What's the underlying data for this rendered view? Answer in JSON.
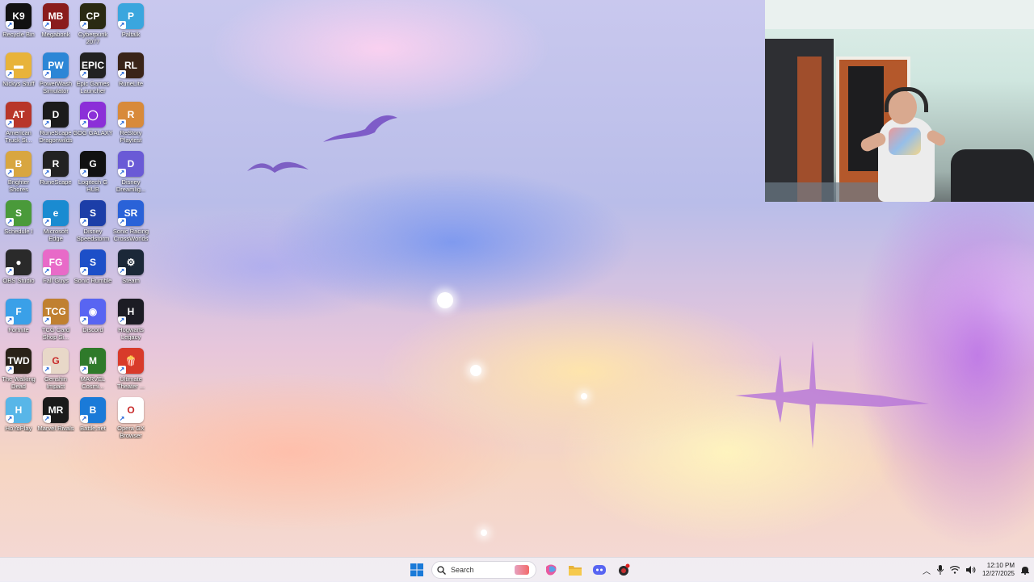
{
  "desktop_icons": [
    {
      "label": "Recycle Bin",
      "icon": "k9-icon",
      "color": "#111111",
      "glyph": "K9"
    },
    {
      "label": "Megabonk",
      "icon": "megabonk-icon",
      "color": "#8a1c1c",
      "glyph": "MB"
    },
    {
      "label": "Cyberpunk 2077",
      "icon": "cyberpunk-icon",
      "color": "#2a2a12",
      "glyph": "CP"
    },
    {
      "label": "Paltalk",
      "icon": "paltalk-icon",
      "color": "#3aa6de",
      "glyph": "P"
    },
    {
      "label": "Nickys Stuff",
      "icon": "folder-icon",
      "color": "#e8b33a",
      "glyph": "▬"
    },
    {
      "label": "PowerWash Simulator",
      "icon": "powerwash-icon",
      "color": "#2c86d6",
      "glyph": "PW"
    },
    {
      "label": "Epic Games Launcher",
      "icon": "epic-games-icon",
      "color": "#222222",
      "glyph": "EPIC"
    },
    {
      "label": "RuneLite",
      "icon": "runelite-icon",
      "color": "#3a2418",
      "glyph": "RL"
    },
    {
      "label": "American Truck Si...",
      "icon": "ats-icon",
      "color": "#b8362a",
      "glyph": "AT"
    },
    {
      "label": "RuneScape Dragonwilds",
      "icon": "dragonwilds-icon",
      "color": "#1b1b1b",
      "glyph": "D"
    },
    {
      "label": "GOG GALAXY",
      "icon": "gog-icon",
      "color": "#8b2fd8",
      "glyph": "◯"
    },
    {
      "label": "ReStory Playtest",
      "icon": "restory-icon",
      "color": "#d88a3a",
      "glyph": "R"
    },
    {
      "label": "Brighter Shores",
      "icon": "brighter-shores-icon",
      "color": "#d8a640",
      "glyph": "B"
    },
    {
      "label": "RuneScape",
      "icon": "runescape-icon",
      "color": "#222222",
      "glyph": "R"
    },
    {
      "label": "Logitech G HUB",
      "icon": "logitech-icon",
      "color": "#111111",
      "glyph": "G"
    },
    {
      "label": "Disney Dreamlig...",
      "icon": "disney-dreamlight-icon",
      "color": "#6a5ad6",
      "glyph": "D"
    },
    {
      "label": "Schedule I",
      "icon": "schedule-icon",
      "color": "#4a9a3a",
      "glyph": "S"
    },
    {
      "label": "Microsoft Edge",
      "icon": "edge-icon",
      "color": "#1a8bd1",
      "glyph": "e"
    },
    {
      "label": "Disney Speedstorm",
      "icon": "speedstorm-icon",
      "color": "#1c3ea8",
      "glyph": "S"
    },
    {
      "label": "Sonic Racing CrossWorlds",
      "icon": "sonic-racing-icon",
      "color": "#2a62d8",
      "glyph": "SR"
    },
    {
      "label": "OBS Studio",
      "icon": "obs-icon",
      "color": "#2a2a2a",
      "glyph": "●"
    },
    {
      "label": "Fall Guys",
      "icon": "fall-guys-icon",
      "color": "#e86ac8",
      "glyph": "FG"
    },
    {
      "label": "Sonic Rumble",
      "icon": "sonic-rumble-icon",
      "color": "#1d4fc8",
      "glyph": "S"
    },
    {
      "label": "Steam",
      "icon": "steam-icon",
      "color": "#1b2838",
      "glyph": "⚙"
    },
    {
      "label": "Fortnite",
      "icon": "fortnite-icon",
      "color": "#3aa0e8",
      "glyph": "F"
    },
    {
      "label": "TCG Card Shop Si...",
      "icon": "tcg-icon",
      "color": "#c08030",
      "glyph": "TCG"
    },
    {
      "label": "Discord",
      "icon": "discord-icon",
      "color": "#5865f2",
      "glyph": "◉"
    },
    {
      "label": "Hogwarts Legacy",
      "icon": "hogwarts-icon",
      "color": "#1c1c24",
      "glyph": "H"
    },
    {
      "label": "The Walking Dead",
      "icon": "walking-dead-icon",
      "color": "#2a2218",
      "glyph": "TWD"
    },
    {
      "label": "Genshin Impact",
      "icon": "genshin-icon",
      "color": "#e8d8c8",
      "glyph": "G"
    },
    {
      "label": "MARVEL Cosmi...",
      "icon": "marvel-cosmic-icon",
      "color": "#2f7a2a",
      "glyph": "M"
    },
    {
      "label": "Ultimate Theater ...",
      "icon": "ultimate-theater-icon",
      "color": "#d83a2a",
      "glyph": "🍿"
    },
    {
      "label": "HoYoPlay",
      "icon": "hoyoplay-icon",
      "color": "#58b6e8",
      "glyph": "H"
    },
    {
      "label": "Marvel Rivals",
      "icon": "marvel-rivals-icon",
      "color": "#1a1a1a",
      "glyph": "MR"
    },
    {
      "label": "Battle.net",
      "icon": "battlenet-icon",
      "color": "#1a7ad8",
      "glyph": "B"
    },
    {
      "label": "Opera GX Browser",
      "icon": "opera-gx-icon",
      "color": "#ffffff",
      "glyph": "O"
    }
  ],
  "taskbar": {
    "search_label": "Search",
    "apps": [
      {
        "name": "windows-start",
        "color": "#1a7ad8"
      },
      {
        "name": "copilot",
        "color": "#e85aa0"
      },
      {
        "name": "file-explorer",
        "color": "#e8b33a"
      },
      {
        "name": "discord",
        "color": "#5865f2"
      },
      {
        "name": "red-app",
        "color": "#c83030"
      }
    ]
  },
  "tray": {
    "time": "12:10 PM",
    "date": "12/27/2025"
  }
}
